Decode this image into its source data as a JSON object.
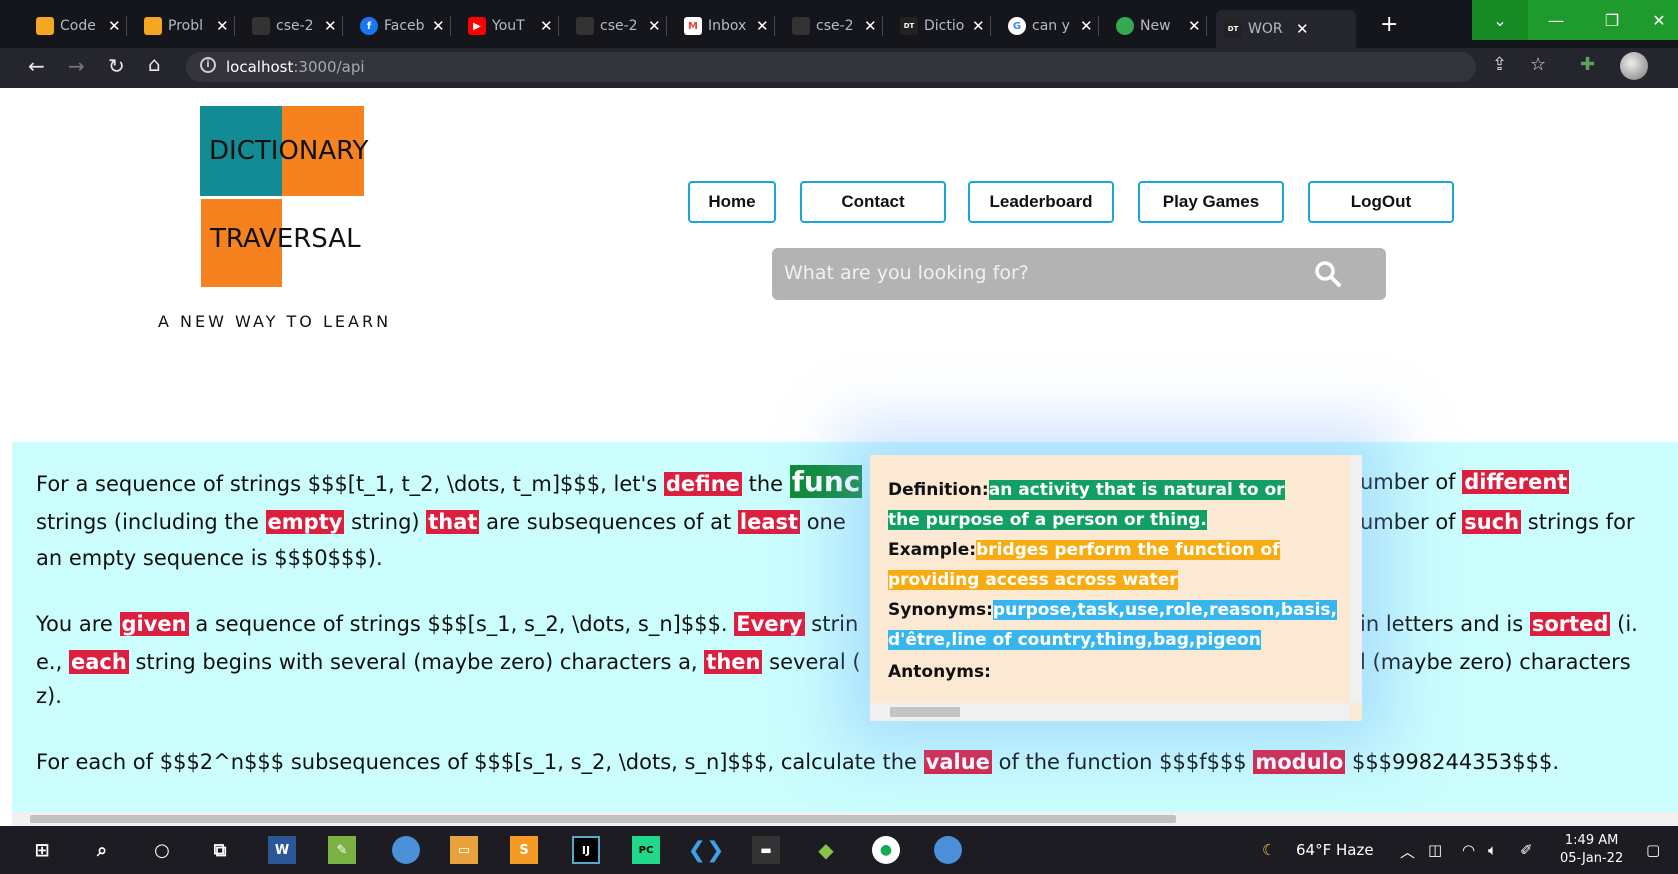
{
  "browser": {
    "tabs": [
      {
        "title": "Code",
        "favicon_color": "#f5a623"
      },
      {
        "title": "Probl",
        "favicon_color": "#f5a623"
      },
      {
        "title": "cse-2",
        "favicon_color": "#333333"
      },
      {
        "title": "Faceb",
        "favicon_color": "#1877f2"
      },
      {
        "title": "YouT",
        "favicon_color": "#ff0000"
      },
      {
        "title": "cse-2",
        "favicon_color": "#333333"
      },
      {
        "title": "Inbox",
        "favicon_color": "#ea4335"
      },
      {
        "title": "cse-2",
        "favicon_color": "#333333"
      },
      {
        "title": "Dictio",
        "favicon_color": "#222222"
      },
      {
        "title": "can y",
        "favicon_color": "#4285f4"
      },
      {
        "title": "New",
        "favicon_color": "#34a853"
      },
      {
        "title": "WOR",
        "favicon_color": "#222222"
      }
    ],
    "url_host": "localhost",
    "url_path": ":3000/api"
  },
  "site": {
    "logo_line1_a": "DICTI",
    "logo_line1_b": "ONARY",
    "logo_line2_a": "TRAV",
    "logo_line2_b": "ERSAL",
    "tagline": "A NEW WAY TO LEARN",
    "nav": [
      "Home",
      "Contact",
      "Leaderboard",
      "Play Games",
      "LogOut"
    ],
    "search_placeholder": "What are you looking for?"
  },
  "content": {
    "p1_l1_a": "For a sequence of strings $$$[t_1, t_2, \\dots, t_m]$$$, let's ",
    "p1_l1_w1": "define",
    "p1_l1_b": " the ",
    "p1_l1_w2": "func",
    "p1_l1_c": "umber of ",
    "p1_l1_w3": "different",
    "p1_l2_a": "strings (including the ",
    "p1_l2_w1": "empty",
    "p1_l2_b": " string) ",
    "p1_l2_w2": "that",
    "p1_l2_c": " are subsequences of at ",
    "p1_l2_w3": "least",
    "p1_l2_d": " one",
    "p1_l2_e": "umber of ",
    "p1_l2_w4": "such",
    "p1_l2_f": " strings for",
    "p1_l3": "an empty sequence is $$$0$$$).",
    "p2_l1_a": "You are ",
    "p2_l1_w1": "given",
    "p2_l1_b": " a sequence of strings $$$[s_1, s_2, \\dots, s_n]$$$. ",
    "p2_l1_w2": "Every",
    "p2_l1_c": " strin",
    "p2_l1_d": "in letters and is ",
    "p2_l1_w3": "sorted",
    "p2_l1_e": " (i.",
    "p2_l2_a": "e., ",
    "p2_l2_w1": "each",
    "p2_l2_b": " string begins with several (maybe zero) characters a, ",
    "p2_l2_w2": "then",
    "p2_l2_c": " several (",
    "p2_l2_d": "l (maybe zero) characters",
    "p2_l3": "z).",
    "p3_a": "For each of $$$2^n$$$ subsequences of $$$[s_1, s_2, \\dots, s_n]$$$, calculate the ",
    "p3_w1": "value",
    "p3_b": " of the function $$$f$$$ ",
    "p3_w2": "modulo",
    "p3_c": " $$$998244353$$$."
  },
  "popup": {
    "definition_label": "Definition:",
    "definition_l1": "an activity that is natural to or",
    "definition_l2": "the purpose of a person or thing.",
    "example_label": "Example:",
    "example_l1": "bridges perform the function of",
    "example_l2": "providing access across water",
    "synonyms_label": "Synonyms:",
    "synonyms_l1": "purpose,task,use,role,reason,basis,",
    "synonyms_l2": "d'être,line of country,thing,bag,pigeon",
    "antonyms_label": "Antonyms:"
  },
  "taskbar": {
    "weather": "64°F  Haze",
    "time": "1:49 AM",
    "date": "05-Jan-22"
  }
}
